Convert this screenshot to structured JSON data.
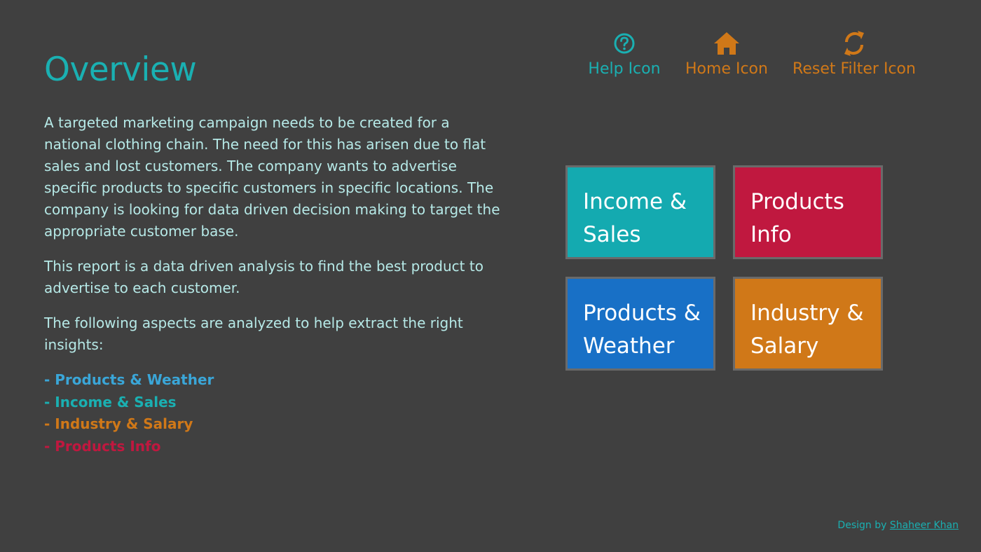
{
  "page": {
    "title": "Overview",
    "colors": {
      "background": "#404040",
      "teal": "#1ab0b2",
      "crimson": "#c0183f",
      "blue": "#1870c6",
      "orange": "#d07818",
      "body_text": "#b6e9e7"
    }
  },
  "intro": {
    "paragraph1": "A targeted marketing campaign needs to be created for a national clothing chain. The need for this has arisen due to flat sales and lost customers. The company wants to advertise specific products to specific customers in specific locations. The company is looking for data driven decision making to target the appropriate customer base.",
    "paragraph2": "This report is a data driven analysis to find the best product to advertise to each customer.",
    "paragraph3": "The following aspects are analyzed to help extract the right insights:"
  },
  "aspects": [
    {
      "label": "- Products & Weather",
      "color": "#3aa6d8"
    },
    {
      "label": "- Income & Sales",
      "color": "#1ab0b2"
    },
    {
      "label": "- Industry & Salary",
      "color": "#d07818"
    },
    {
      "label": "- Products Info",
      "color": "#c0183f"
    }
  ],
  "nav_icons": {
    "help": {
      "label": "Help Icon",
      "icon": "question-circle",
      "color": "#1ab0b2"
    },
    "home": {
      "label": "Home Icon",
      "icon": "house",
      "color": "#d07818"
    },
    "reset": {
      "label": "Reset Filter Icon",
      "icon": "refresh-arrows",
      "color": "#d07818"
    }
  },
  "tiles": {
    "income_sales": {
      "line1": "Income &",
      "line2": "Sales",
      "color": "#14aab0"
    },
    "products_info": {
      "line1": "Products",
      "line2": "Info",
      "color": "#c0183f"
    },
    "products_weather": {
      "line1": "Products &",
      "line2": "Weather",
      "color": "#1870c6"
    },
    "industry_salary": {
      "line1": "Industry &",
      "line2": "Salary",
      "color": "#d07818"
    }
  },
  "footer": {
    "prefix": "Design by ",
    "author": "Shaheer Khan"
  }
}
